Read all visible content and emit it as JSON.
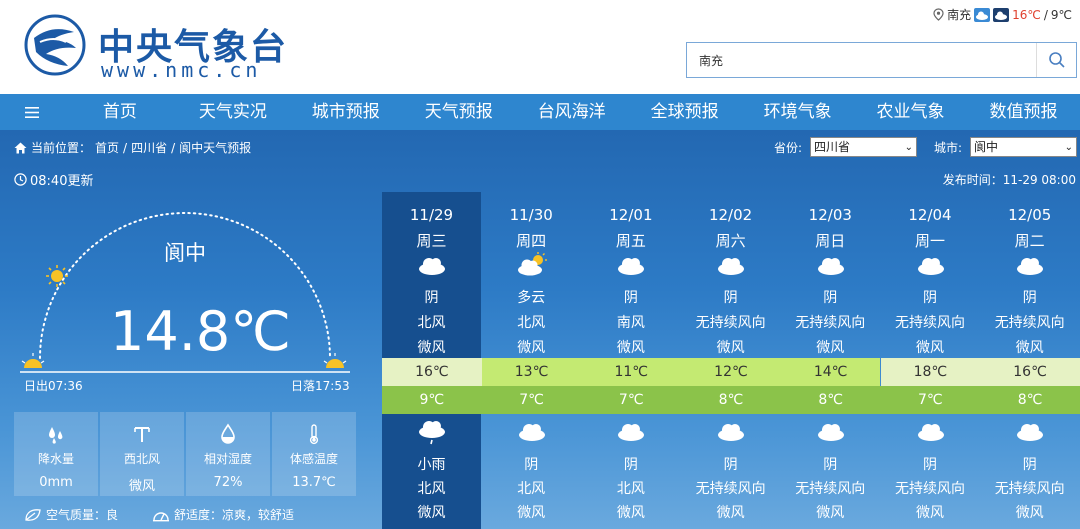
{
  "header": {
    "logo_cn": "中央气象台",
    "logo_en": "www.nmc.cn",
    "top_city": "南充",
    "top_high": "16℃",
    "top_sep": " / ",
    "top_low": "9℃",
    "search_value": "南充"
  },
  "nav": {
    "items": [
      "首页",
      "天气实况",
      "城市预报",
      "天气预报",
      "台风海洋",
      "全球预报",
      "环境气象",
      "农业气象",
      "数值预报"
    ]
  },
  "breadcrumb": {
    "label": "当前位置：",
    "items": [
      "首页",
      "四川省",
      "阆中天气预报"
    ],
    "sep": "/"
  },
  "selectors": {
    "province_label": "省份:",
    "province_value": "四川省",
    "city_label": "城市:",
    "city_value": "阆中"
  },
  "update_time": "08:40更新",
  "publish_time": "发布时间：11-29 08:00",
  "current": {
    "city": "阆中",
    "temp": "14.8℃",
    "sunrise": "日出07:36",
    "sunset": "日落17:53",
    "stats": [
      {
        "label": "降水量",
        "value": "0mm",
        "icon": "rain-drops-icon"
      },
      {
        "label": "西北风",
        "value": "微风",
        "icon": "wind-icon"
      },
      {
        "label": "相对湿度",
        "value": "72%",
        "icon": "humidity-icon"
      },
      {
        "label": "体感温度",
        "value": "13.7℃",
        "icon": "thermometer-icon"
      }
    ],
    "air_quality": "空气质量：良",
    "comfort": "舒适度：凉爽，较舒适"
  },
  "forecast": [
    {
      "date": "11/29",
      "week": "周三",
      "day_icon": "cloudy-icon",
      "day_weather": "阴",
      "day_wind_dir": "北风",
      "day_wind_speed": "微风",
      "high": "16℃",
      "low": "9℃",
      "night_icon": "light-rain-icon",
      "night_weather": "小雨",
      "night_wind_dir": "北风",
      "night_wind_speed": "微风"
    },
    {
      "date": "11/30",
      "week": "周四",
      "day_icon": "partly-cloudy-icon",
      "day_weather": "多云",
      "day_wind_dir": "北风",
      "day_wind_speed": "微风",
      "high": "13℃",
      "low": "7℃",
      "night_icon": "cloudy-icon",
      "night_weather": "阴",
      "night_wind_dir": "北风",
      "night_wind_speed": "微风"
    },
    {
      "date": "12/01",
      "week": "周五",
      "day_icon": "cloudy-icon",
      "day_weather": "阴",
      "day_wind_dir": "南风",
      "day_wind_speed": "微风",
      "high": "11℃",
      "low": "7℃",
      "night_icon": "cloudy-icon",
      "night_weather": "阴",
      "night_wind_dir": "北风",
      "night_wind_speed": "微风"
    },
    {
      "date": "12/02",
      "week": "周六",
      "day_icon": "cloudy-icon",
      "day_weather": "阴",
      "day_wind_dir": "无持续风向",
      "day_wind_speed": "微风",
      "high": "12℃",
      "low": "8℃",
      "night_icon": "cloudy-icon",
      "night_weather": "阴",
      "night_wind_dir": "无持续风向",
      "night_wind_speed": "微风"
    },
    {
      "date": "12/03",
      "week": "周日",
      "day_icon": "cloudy-icon",
      "day_weather": "阴",
      "day_wind_dir": "无持续风向",
      "day_wind_speed": "微风",
      "high": "14℃",
      "low": "8℃",
      "night_icon": "cloudy-icon",
      "night_weather": "阴",
      "night_wind_dir": "无持续风向",
      "night_wind_speed": "微风"
    },
    {
      "date": "12/04",
      "week": "周一",
      "day_icon": "cloudy-icon",
      "day_weather": "阴",
      "day_wind_dir": "无持续风向",
      "day_wind_speed": "微风",
      "high": "18℃",
      "low": "7℃",
      "night_icon": "cloudy-icon",
      "night_weather": "阴",
      "night_wind_dir": "无持续风向",
      "night_wind_speed": "微风"
    },
    {
      "date": "12/05",
      "week": "周二",
      "day_icon": "cloudy-icon",
      "day_weather": "阴",
      "day_wind_dir": "无持续风向",
      "day_wind_speed": "微风",
      "high": "16℃",
      "low": "8℃",
      "night_icon": "cloudy-icon",
      "night_weather": "阴",
      "night_wind_dir": "无持续风向",
      "night_wind_speed": "微风"
    }
  ],
  "colors": {
    "brand": "#1c5aa6",
    "nav_bg": "#2e86cf",
    "high_band": [
      "#e6f2c4",
      "#c4ea72",
      "#c4ea72",
      "#c4ea72",
      "#c4ea72",
      "#e6f2c4",
      "#e6f2c4"
    ],
    "low_band": "#8bc34a"
  }
}
